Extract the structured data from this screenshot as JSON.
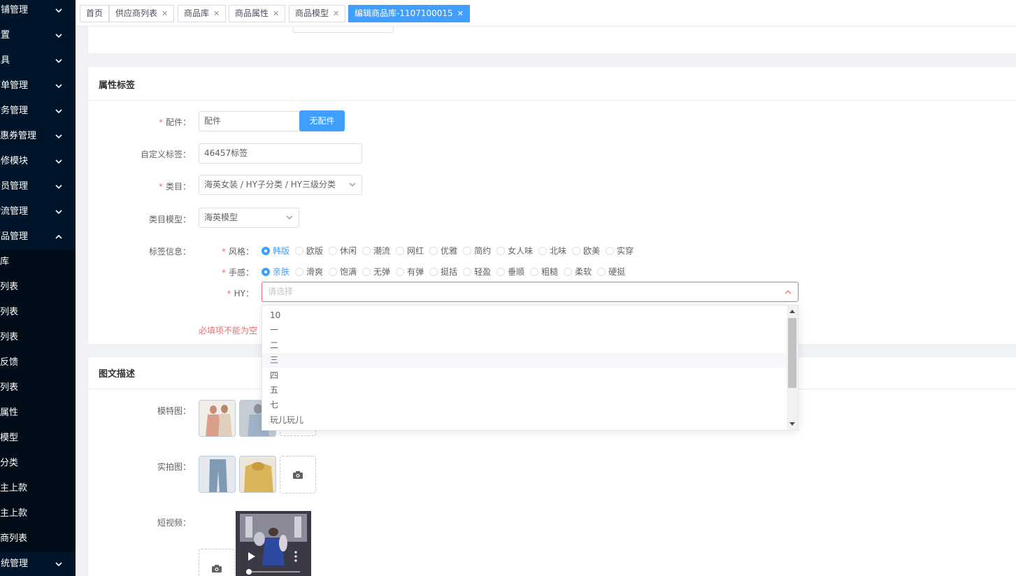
{
  "sidebar": {
    "items": [
      {
        "label": "店铺管理",
        "expanded": false
      },
      {
        "label": "设置",
        "expanded": false
      },
      {
        "label": "工具",
        "expanded": false
      },
      {
        "label": "订单管理",
        "expanded": false
      },
      {
        "label": "财务管理",
        "expanded": false
      },
      {
        "label": "优惠券管理",
        "expanded": false
      },
      {
        "label": "装修模块",
        "expanded": false
      },
      {
        "label": "会员管理",
        "expanded": false
      },
      {
        "label": "物流管理",
        "expanded": false
      },
      {
        "label": "商品管理",
        "expanded": true
      }
    ],
    "subitems": [
      "商品库",
      "商品列表",
      "分类列表",
      "品牌列表",
      "评价反馈",
      "规格列表",
      "商品属性",
      "商品模型",
      "海英分类",
      "供应商自主上款",
      "自营自主上款",
      "供应商列表"
    ],
    "bottom_item": {
      "label": "系统管理"
    }
  },
  "tabs": [
    {
      "label": "首页",
      "closable": false
    },
    {
      "label": "供应商列表",
      "closable": true
    },
    {
      "label": "商品库",
      "closable": true
    },
    {
      "label": "商品属性",
      "closable": true
    },
    {
      "label": "商品模型",
      "closable": true
    },
    {
      "label": "编辑商品库-1107100015",
      "closable": true,
      "active": true
    }
  ],
  "attributes": {
    "title": "属性标签",
    "accessory": {
      "label": "配件：",
      "value": "配件",
      "button": "无配件"
    },
    "custom_tag": {
      "label": "自定义标签：",
      "value": "46457标签"
    },
    "category": {
      "label": "类目：",
      "value": "海英女装 / HY子分类 / HY三级分类"
    },
    "category_model": {
      "label": "类目模型：",
      "value": "海英模型"
    },
    "tag_info": {
      "label": "标签信息："
    },
    "style": {
      "label": "风格：",
      "options": [
        "韩版",
        "欧版",
        "休闲",
        "潮流",
        "网红",
        "优雅",
        "简约",
        "女人味",
        "北味",
        "欧美",
        "实穿"
      ],
      "selected": "韩版"
    },
    "feel": {
      "label": "手感：",
      "options": [
        "亲肤",
        "滑爽",
        "饱满",
        "无弹",
        "有弹",
        "挺括",
        "轻盈",
        "垂顺",
        "粗糙",
        "柔软",
        "硬挺"
      ],
      "selected": "亲肤"
    },
    "hy": {
      "label": "HY：",
      "placeholder": "请选择"
    },
    "error": "必填项不能为空",
    "hy_options": [
      "10",
      "一",
      "二",
      "三",
      "四",
      "五",
      "七",
      "玩儿玩儿"
    ],
    "hy_hover": "三"
  },
  "description": {
    "title": "图文描述",
    "model_images_label": "模特图：",
    "real_images_label": "实拍图：",
    "video_label": "短视频："
  },
  "colors": {
    "sidebar_bg": "#001529",
    "primary": "#409eff",
    "error": "#f56c6c"
  }
}
